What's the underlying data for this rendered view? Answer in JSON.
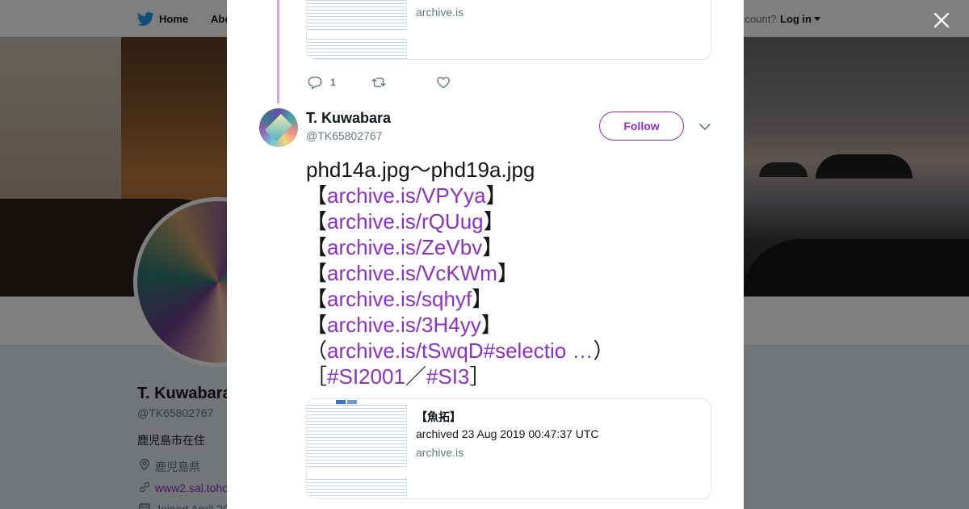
{
  "nav": {
    "home_label": "Home",
    "about_label": "Abo",
    "account_text": "ccount?",
    "login_label": "Log in"
  },
  "profile": {
    "name": "T. Kuwabara",
    "handle": "@TK65802767",
    "bio": "鹿児島市在住",
    "location": "鹿児島県",
    "website": "www2.sal.toho",
    "joined": "Joined April 20"
  },
  "modal": {
    "prev_card": {
      "domain": "archive.is"
    },
    "prev_actions": {
      "reply_count": "1"
    },
    "tweet": {
      "author_name": "T. Kuwabara",
      "author_handle": "@TK65802767",
      "follow_label": "Follow",
      "lines": [
        {
          "pre": "phd14a.jpg～phd19a.jpg",
          "link": "",
          "post": ""
        },
        {
          "pre": "【",
          "link": "archive.is/VPYya",
          "post": "】"
        },
        {
          "pre": "【",
          "link": "archive.is/rQUug",
          "post": "】"
        },
        {
          "pre": "【",
          "link": "archive.is/ZeVbv",
          "post": "】"
        },
        {
          "pre": "【",
          "link": "archive.is/VcKWm",
          "post": "】"
        },
        {
          "pre": "【",
          "link": "archive.is/sqhyf",
          "post": "】"
        },
        {
          "pre": "【",
          "link": "archive.is/3H4yy",
          "post": "】"
        },
        {
          "pre": "（",
          "link": "archive.is/tSwqD#selectio …",
          "post": "）"
        }
      ],
      "hashtag_line": {
        "open": "［",
        "tag1": "#SI2001",
        "sep": "／",
        "tag2": "#SI3",
        "close": "］"
      },
      "card": {
        "title": "【魚拓】",
        "description": "archived 23 Aug 2019 00:47:37 UTC",
        "domain": "archive.is"
      }
    }
  },
  "colors": {
    "link": "#8e2fc9",
    "thread_line": "#c9a3e5",
    "overlay": "rgba(0,0,0,0.5)"
  },
  "icons": [
    "twitter-bird-icon",
    "close-icon",
    "reply-icon",
    "retweet-icon",
    "heart-icon",
    "chevron-down-icon",
    "location-pin-icon",
    "link-icon",
    "calendar-icon"
  ]
}
